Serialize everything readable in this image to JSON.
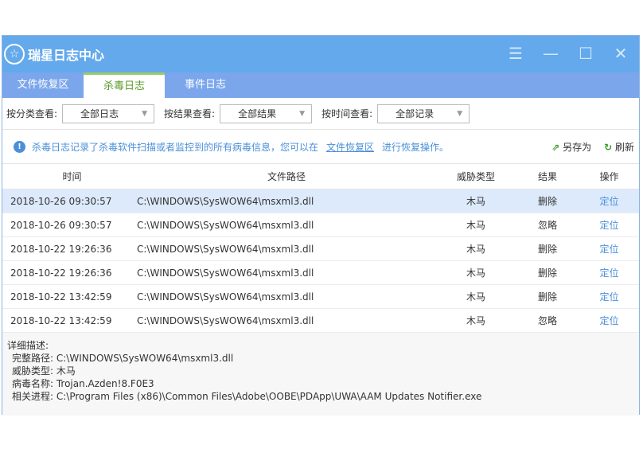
{
  "window": {
    "title": "瑞星日志中心",
    "controls": [
      "☰",
      "—",
      "☐",
      "✕"
    ]
  },
  "tabs": [
    {
      "label": "文件恢复区"
    },
    {
      "label": "杀毒日志"
    },
    {
      "label": "事件日志"
    }
  ],
  "filters": [
    {
      "label": "按分类查看:",
      "value": "全部日志"
    },
    {
      "label": "按结果查看:",
      "value": "全部结果"
    },
    {
      "label": "按时间查看:",
      "value": "全部记录"
    }
  ],
  "info": {
    "text": "杀毒日志记录了杀毒软件扫描或者监控到的所有病毒信息，您可以在",
    "link": "文件恢复区",
    "suffix": "进行恢复操作。",
    "save_as": "另存为",
    "refresh": "刷新"
  },
  "table": {
    "headers": [
      "时间",
      "文件路径",
      "威胁类型",
      "结果",
      "操作"
    ],
    "rows": [
      [
        "2018-10-26 09:30:57",
        "C:\\WINDOWS\\SysWOW64\\msxml3.dll",
        "木马",
        "删除",
        "定位"
      ],
      [
        "2018-10-26 09:30:57",
        "C:\\WINDOWS\\SysWOW64\\msxml3.dll",
        "木马",
        "忽略",
        "定位"
      ],
      [
        "2018-10-22 19:26:36",
        "C:\\WINDOWS\\SysWOW64\\msxml3.dll",
        "木马",
        "删除",
        "定位"
      ],
      [
        "2018-10-22 19:26:36",
        "C:\\WINDOWS\\SysWOW64\\msxml3.dll",
        "木马",
        "删除",
        "定位"
      ],
      [
        "2018-10-22 13:42:59",
        "C:\\WINDOWS\\SysWOW64\\msxml3.dll",
        "木马",
        "删除",
        "定位"
      ],
      [
        "2018-10-22 13:42:59",
        "C:\\WINDOWS\\SysWOW64\\msxml3.dll",
        "木马",
        "忽略",
        "定位"
      ]
    ]
  },
  "detail": {
    "title": "详细描述:",
    "lines": [
      "完整路径: C:\\WINDOWS\\SysWOW64\\msxml3.dll",
      "威胁类型: 木马",
      "病毒名称: Trojan.Azden!8.F0E3",
      "相关进程: C:\\Program Files (x86)\\Common Files\\Adobe\\OOBE\\PDApp\\UWA\\AAM Updates Notifier.exe"
    ]
  }
}
